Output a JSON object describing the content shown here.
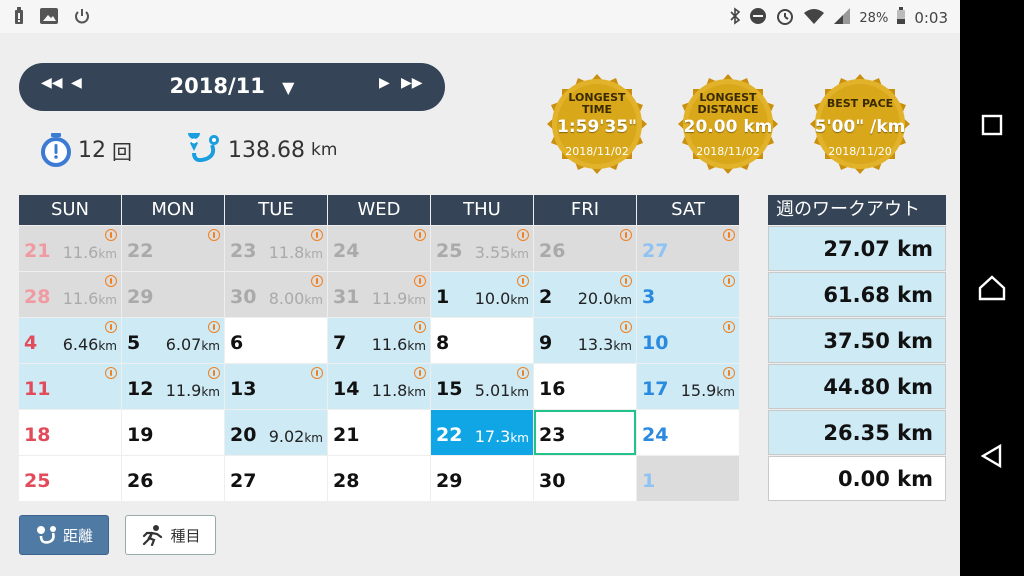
{
  "status_bar": {
    "battery": "28%",
    "time": "0:03"
  },
  "header": {
    "month": "2018/11",
    "dropdown_arrow": "▼"
  },
  "summary": {
    "count_value": "12",
    "count_unit": "回",
    "distance_value": "138.68",
    "distance_unit": "km"
  },
  "medals": [
    {
      "title": "LONGEST TIME",
      "value": "1:59'35\"",
      "date": "2018/11/02"
    },
    {
      "title": "LONGEST DISTANCE",
      "value": "20.00 km",
      "date": "2018/11/02"
    },
    {
      "title": "BEST PACE",
      "value": "5'00\" /km",
      "date": "2018/11/20"
    }
  ],
  "calendar": {
    "weekdays": [
      "SUN",
      "MON",
      "TUE",
      "WED",
      "THU",
      "FRI",
      "SAT"
    ],
    "weeks": [
      [
        {
          "day": "21",
          "dist": "11.6",
          "state": "gray",
          "run": true
        },
        {
          "day": "22",
          "dist": "",
          "state": "gray",
          "run": true
        },
        {
          "day": "23",
          "dist": "11.8",
          "state": "gray",
          "run": true
        },
        {
          "day": "24",
          "dist": "",
          "state": "gray",
          "run": true
        },
        {
          "day": "25",
          "dist": "3.55",
          "state": "gray",
          "run": true
        },
        {
          "day": "26",
          "dist": "",
          "state": "gray",
          "run": true
        },
        {
          "day": "27",
          "dist": "",
          "state": "gray",
          "run": true
        }
      ],
      [
        {
          "day": "28",
          "dist": "11.6",
          "state": "gray",
          "run": true
        },
        {
          "day": "29",
          "dist": "",
          "state": "gray",
          "run": false
        },
        {
          "day": "30",
          "dist": "8.00",
          "state": "gray",
          "run": true
        },
        {
          "day": "31",
          "dist": "11.9",
          "state": "gray",
          "run": true
        },
        {
          "day": "1",
          "dist": "10.0",
          "state": "blue",
          "run": true
        },
        {
          "day": "2",
          "dist": "20.0",
          "state": "blue",
          "run": true
        },
        {
          "day": "3",
          "dist": "",
          "state": "blue",
          "run": true
        }
      ],
      [
        {
          "day": "4",
          "dist": "6.46",
          "state": "blue",
          "run": true
        },
        {
          "day": "5",
          "dist": "6.07",
          "state": "blue",
          "run": true
        },
        {
          "day": "6",
          "dist": "",
          "state": "white",
          "run": false
        },
        {
          "day": "7",
          "dist": "11.6",
          "state": "blue",
          "run": true
        },
        {
          "day": "8",
          "dist": "",
          "state": "white",
          "run": false
        },
        {
          "day": "9",
          "dist": "13.3",
          "state": "blue",
          "run": true
        },
        {
          "day": "10",
          "dist": "",
          "state": "blue",
          "run": true
        }
      ],
      [
        {
          "day": "11",
          "dist": "",
          "state": "blue",
          "run": true
        },
        {
          "day": "12",
          "dist": "11.9",
          "state": "blue",
          "run": true
        },
        {
          "day": "13",
          "dist": "",
          "state": "blue",
          "run": true
        },
        {
          "day": "14",
          "dist": "11.8",
          "state": "blue",
          "run": true
        },
        {
          "day": "15",
          "dist": "5.01",
          "state": "blue",
          "run": true
        },
        {
          "day": "16",
          "dist": "",
          "state": "white",
          "run": false
        },
        {
          "day": "17",
          "dist": "15.9",
          "state": "blue",
          "run": true
        }
      ],
      [
        {
          "day": "18",
          "dist": "",
          "state": "white",
          "run": false
        },
        {
          "day": "19",
          "dist": "",
          "state": "white",
          "run": false
        },
        {
          "day": "20",
          "dist": "9.02",
          "state": "blue",
          "run": false
        },
        {
          "day": "21",
          "dist": "",
          "state": "white",
          "run": false
        },
        {
          "day": "22",
          "dist": "17.3",
          "state": "today",
          "run": false
        },
        {
          "day": "23",
          "dist": "",
          "state": "selected",
          "run": false
        },
        {
          "day": "24",
          "dist": "",
          "state": "white",
          "run": false
        }
      ],
      [
        {
          "day": "25",
          "dist": "",
          "state": "white",
          "run": false
        },
        {
          "day": "26",
          "dist": "",
          "state": "white",
          "run": false
        },
        {
          "day": "27",
          "dist": "",
          "state": "white",
          "run": false
        },
        {
          "day": "28",
          "dist": "",
          "state": "white",
          "run": false
        },
        {
          "day": "29",
          "dist": "",
          "state": "white",
          "run": false
        },
        {
          "day": "30",
          "dist": "",
          "state": "white",
          "run": false
        },
        {
          "day": "1",
          "dist": "",
          "state": "gray",
          "run": false
        }
      ]
    ],
    "unit": "km"
  },
  "weekly": {
    "title": "週のワークアウト",
    "totals": [
      "27.07 km",
      "61.68 km",
      "37.50 km",
      "44.80 km",
      "26.35 km",
      "0.00 km"
    ]
  },
  "buttons": {
    "distance_label": "距離",
    "type_label": "種目"
  },
  "colors": {
    "header_bg": "#354456",
    "highlight_blue": "#cdeaf5",
    "today": "#10a6e6",
    "sunday": "#e24b5a",
    "saturday": "#2a8ae0",
    "gold": "#d9a71a"
  }
}
